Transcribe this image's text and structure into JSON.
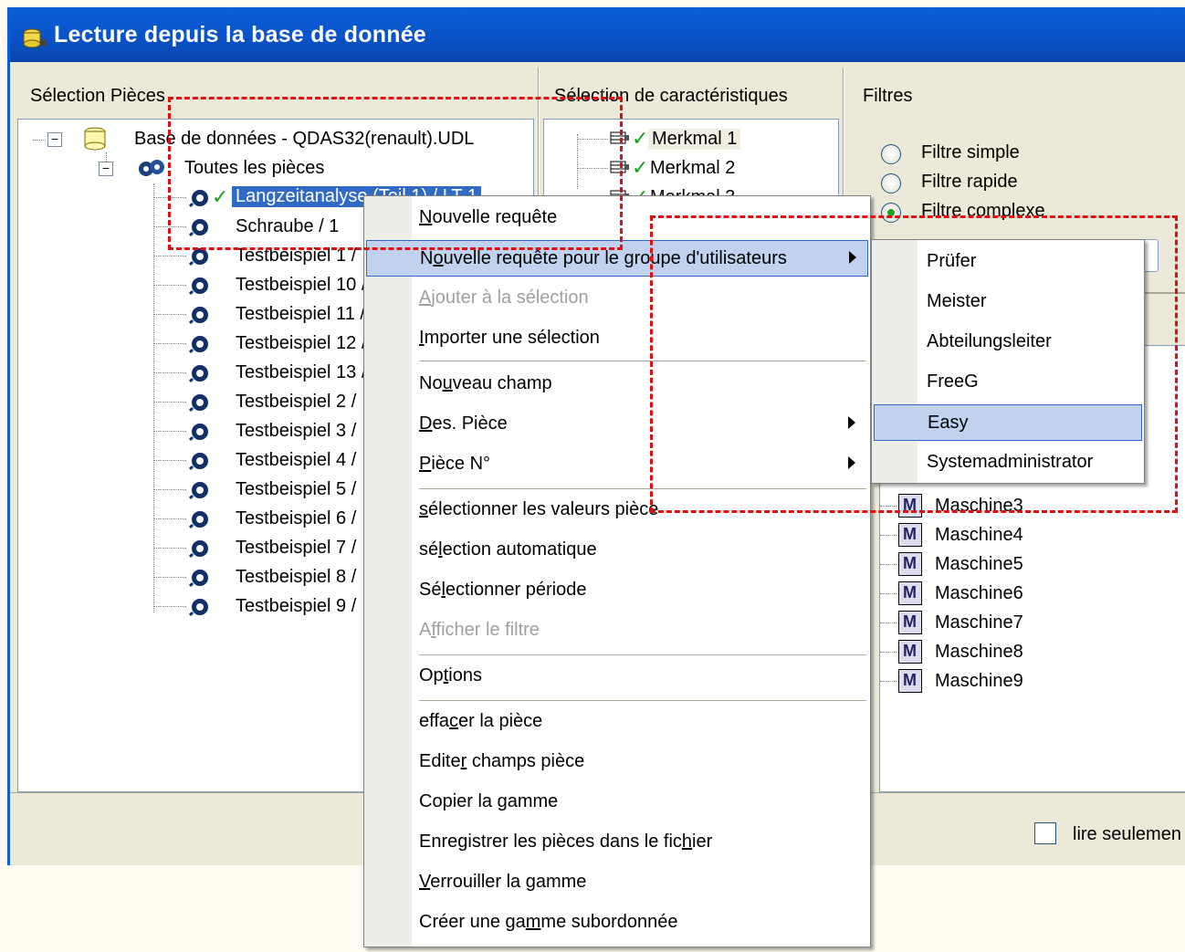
{
  "window": {
    "title": "Lecture depuis la base de donnée"
  },
  "panels": {
    "parts": {
      "header": "Sélection Pièces"
    },
    "characteristics": {
      "header": "Sélection de caractéristiques"
    },
    "filters": {
      "header": "Filtres"
    }
  },
  "parts_tree": {
    "root": "Base de données - QDAS32(renault).UDL",
    "group": "Toutes les pièces",
    "items": [
      "Langzeitanalyse (Teil 1) / LT 1",
      "Schraube / 1",
      "Testbeispiel 1 /",
      "Testbeispiel 10 /",
      "Testbeispiel 11 /",
      "Testbeispiel 12 /",
      "Testbeispiel 13 /",
      "Testbeispiel 2 /",
      "Testbeispiel 3 /",
      "Testbeispiel 4 /",
      "Testbeispiel 5 /",
      "Testbeispiel 6 /",
      "Testbeispiel 7 /",
      "Testbeispiel 8 /",
      "Testbeispiel 9 /"
    ]
  },
  "char_tree": {
    "items": [
      "Merkmal 1",
      "Merkmal 2",
      "Merkmal 3"
    ]
  },
  "filters": {
    "options": [
      "Filtre simple",
      "Filtre rapide",
      "Filtre complexe"
    ],
    "selected": "Filtre complexe",
    "machines": [
      "Maschine3",
      "Maschine4",
      "Maschine5",
      "Maschine6",
      "Maschine7",
      "Maschine8",
      "Maschine9"
    ]
  },
  "footer": {
    "readonly_label": "lire seulemen"
  },
  "context_menu": {
    "items": [
      {
        "label": "Nouvelle requête",
        "u": "N"
      },
      {
        "label": "Nouvelle requête pour le groupe d'utilisateurs",
        "u": "o"
      },
      {
        "label": "Ajouter à la sélection",
        "u": "A"
      },
      {
        "label": "Importer une sélection",
        "u": "I"
      },
      {
        "label": "Nouveau champ",
        "u": "u"
      },
      {
        "label": "Des. Pièce",
        "u": "D"
      },
      {
        "label": "Pièce N°",
        "u": "P"
      },
      {
        "label": "sélectionner les valeurs pièce",
        "u": "s"
      },
      {
        "label": "sélection automatique",
        "u": "l"
      },
      {
        "label": "Sélectionner période",
        "u": "l"
      },
      {
        "label": "Afficher le filtre",
        "u": "f"
      },
      {
        "label": "Options",
        "u": "t"
      },
      {
        "label": "effacer la pièce",
        "u": "c"
      },
      {
        "label": "Editer champs pièce",
        "u": "r"
      },
      {
        "label": "Copier la gamme",
        "u": "g"
      },
      {
        "label": "Enregistrer les pièces dans le fichier",
        "u": "h"
      },
      {
        "label": "Verrouiller la gamme",
        "u": "V"
      },
      {
        "label": "Créer une gamme subordonnée",
        "u": "m"
      }
    ]
  },
  "submenu": {
    "items": [
      "Prüfer",
      "Meister",
      "Abteilungsleiter",
      "FreeG",
      "Easy",
      "Systemadministrator"
    ],
    "highlighted": "Easy"
  },
  "colors": {
    "titlebar": "#0a54c9",
    "highlight": "#316ac5",
    "menu_highlight": "#c1d2ee",
    "annotation": "#e01010"
  }
}
